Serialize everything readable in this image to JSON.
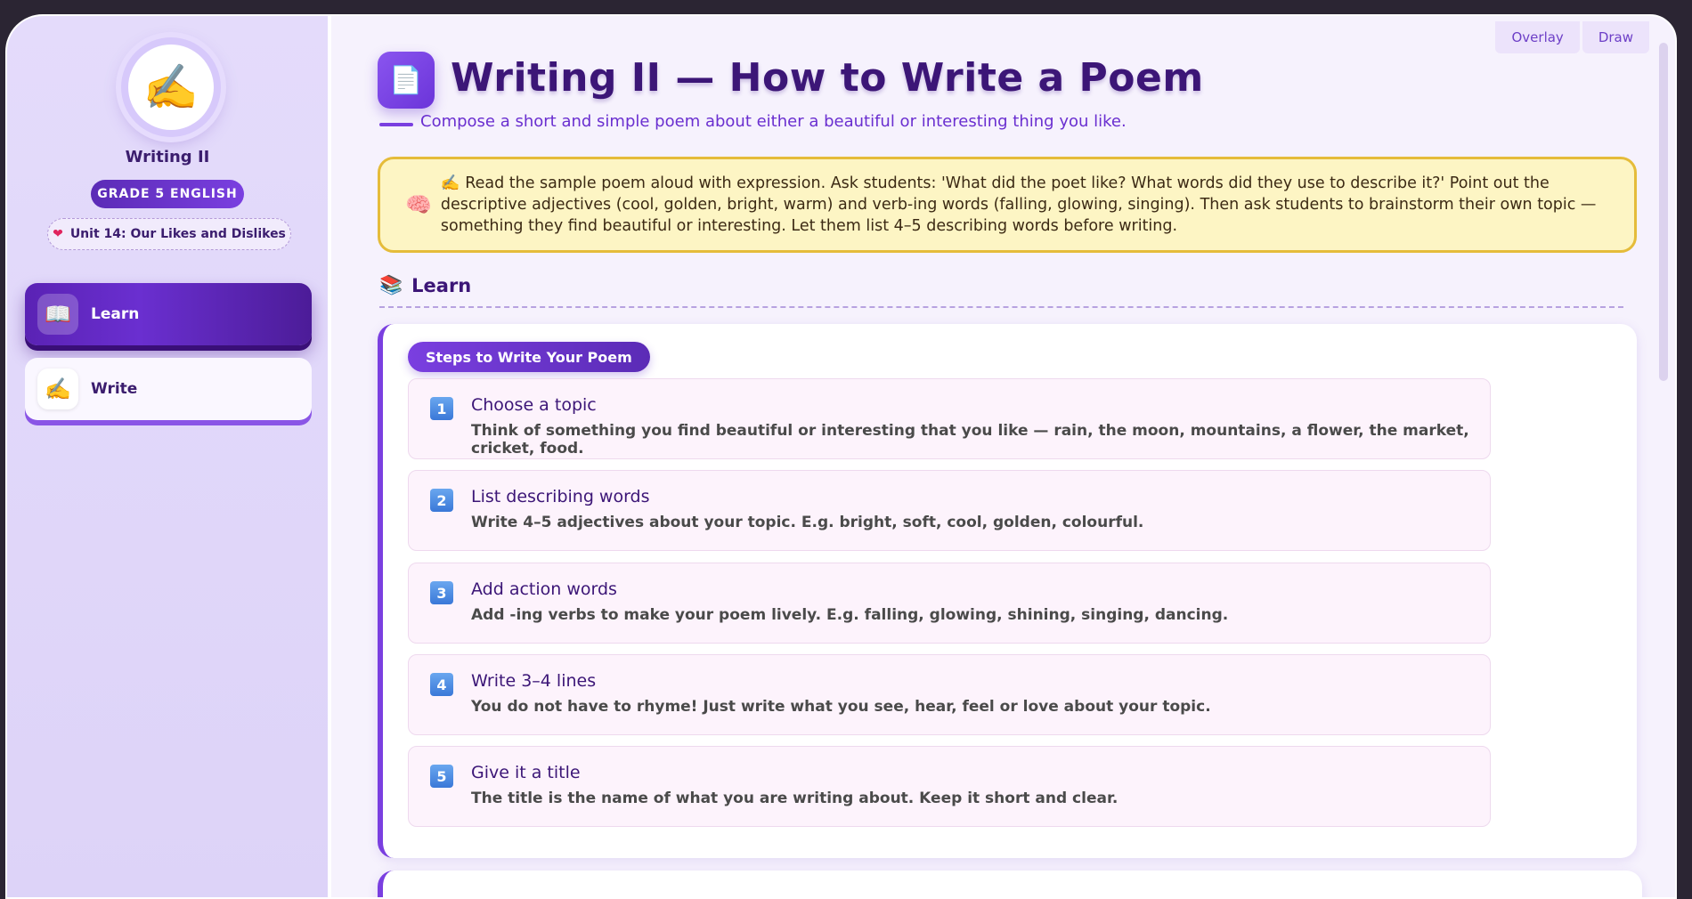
{
  "tools": {
    "overlay": "Overlay",
    "draw": "Draw"
  },
  "sidebar": {
    "avatar_emoji": "✍️",
    "title": "Writing II",
    "grade": "GRADE 5 ENGLISH",
    "unit": "Unit 14: Our Likes and Dislikes",
    "unit_icon": "heart-icon",
    "items": [
      {
        "label": "Learn",
        "emoji": "📖",
        "icon": "book-icon",
        "active": true
      },
      {
        "label": "Write",
        "emoji": "✍️",
        "icon": "writing-hand-icon",
        "active": false
      }
    ]
  },
  "main": {
    "page_icon_emoji": "📄",
    "title": "Writing II — How to Write a Poem",
    "subtitle": "Compose a short and simple poem about either a beautiful or interesting thing you like.",
    "note": {
      "icon": "brain-icon",
      "emoji": "🧠",
      "text": "✍️ Read the sample poem aloud with expression. Ask students: 'What did the poet like? What words did they use to describe it?' Point out the descriptive adjectives (cool, golden, bright, warm) and verb-ing words (falling, glowing, singing). Then ask students to brainstorm their own topic — something they find beautiful or interesting. Let them list 4–5 describing words before writing."
    },
    "section": {
      "emoji": "📚",
      "title": "Learn"
    },
    "steps_label": "Steps to Write Your Poem",
    "steps": [
      {
        "num": "1",
        "title": "Choose a topic",
        "desc": "Think of something you find beautiful or interesting that you like — rain, the moon, mountains, a flower, the market, cricket, food."
      },
      {
        "num": "2",
        "title": "List describing words",
        "desc": "Write 4–5 adjectives about your topic. E.g. bright, soft, cool, golden, colourful."
      },
      {
        "num": "3",
        "title": "Add action words",
        "desc": "Add -ing verbs to make your poem lively. E.g. falling, glowing, shining, singing, dancing."
      },
      {
        "num": "4",
        "title": "Write 3–4 lines",
        "desc": "You do not have to rhyme! Just write what you see, hear, feel or love about your topic."
      },
      {
        "num": "5",
        "title": "Give it a title",
        "desc": "The title is the name of what you are writing about. Keep it short and clear."
      }
    ]
  },
  "colors": {
    "accent": "#7a3fe0",
    "title": "#3c1677",
    "note_bg": "#fdf5c4",
    "note_border": "#e5bc3a"
  }
}
